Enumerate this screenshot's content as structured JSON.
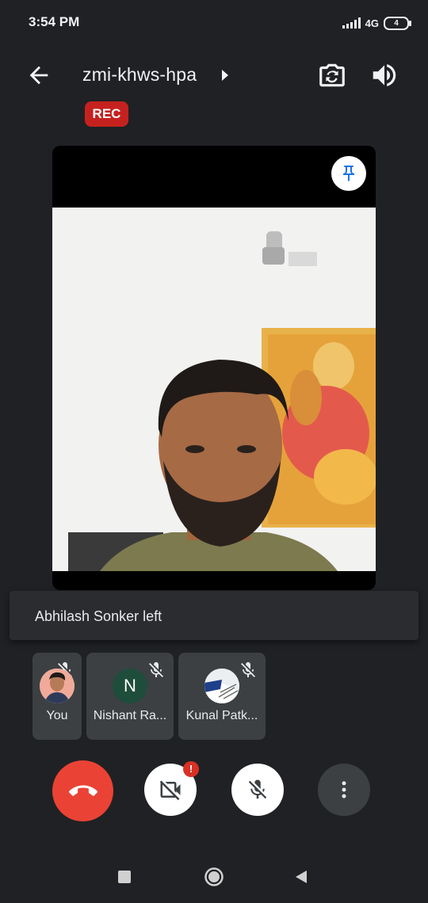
{
  "status": {
    "time": "3:54 PM",
    "network": "4G",
    "battery": "4"
  },
  "header": {
    "meeting_code": "zmi-khws-hpa",
    "icons": [
      "back-arrow-icon",
      "caret-right-icon",
      "switch-camera-icon",
      "speaker-icon"
    ]
  },
  "recording": {
    "label": "REC"
  },
  "main_video": {
    "icons": [
      "pin-icon"
    ]
  },
  "toast": {
    "message": "Abhilash Sonker left"
  },
  "participants": [
    {
      "name": "You",
      "avatar": "photo",
      "muted": true
    },
    {
      "name": "Nishant Ra...",
      "avatar_letter": "N",
      "muted": true
    },
    {
      "name": "Kunal Patk...",
      "avatar": "photo",
      "muted": true
    }
  ],
  "controls": {
    "camera_alert": "!",
    "icons": [
      "end-call-icon",
      "camera-off-icon",
      "mic-off-icon",
      "more-options-icon"
    ]
  },
  "colors": {
    "background": "#202124",
    "end_call": "#ea4335",
    "rec_badge": "#c5221f",
    "pin_blue": "#1a73e8",
    "avatar_n": "#1e4d3c"
  }
}
